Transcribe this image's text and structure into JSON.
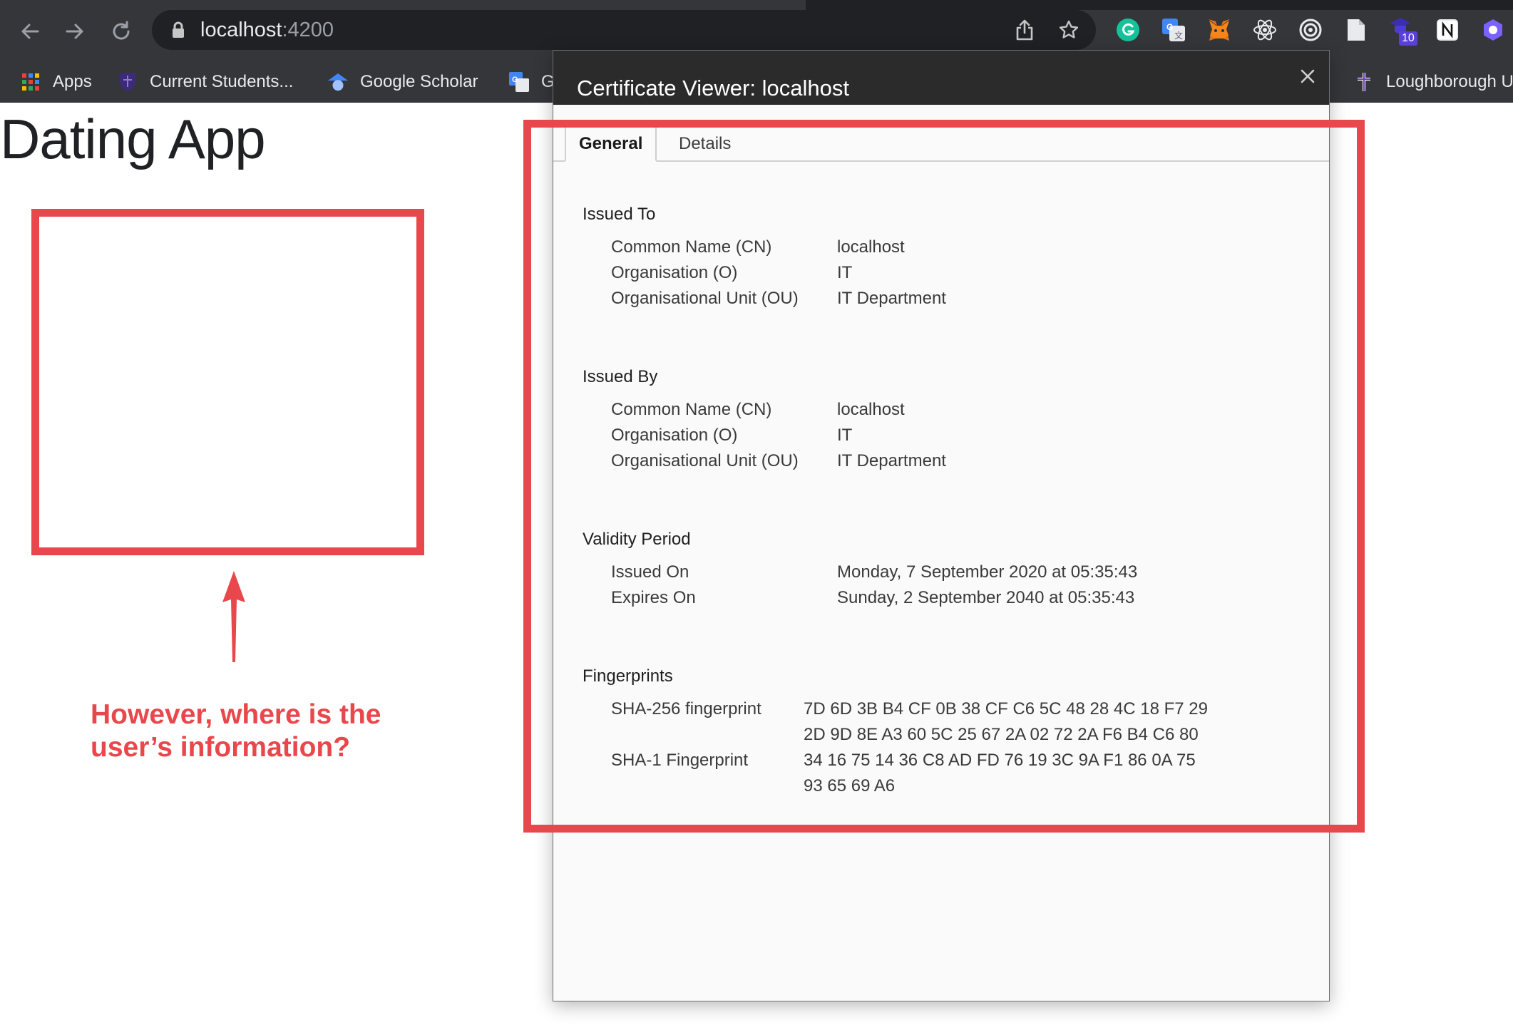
{
  "browser": {
    "url_host": "localhost",
    "url_port": ":4200",
    "bookmarks": [
      {
        "label": "Apps",
        "icon": "apps-grid-icon"
      },
      {
        "label": "Current Students...",
        "icon": "shield-crest-icon"
      },
      {
        "label": "Google Scholar",
        "icon": "scholar-cap-icon"
      },
      {
        "label": "G",
        "icon": "google-translate-icon"
      },
      {
        "label": "Loughborough U",
        "icon": "university-cross-icon"
      }
    ],
    "extension_badge": "10",
    "colors": {
      "chrome_bg": "#35363a",
      "omnibox_bg": "#202124",
      "annotation_red": "#e8474c"
    }
  },
  "page": {
    "title": "Dating App",
    "annotation_text_line1": "However, where is the",
    "annotation_text_line2": "user’s information?"
  },
  "dialog": {
    "title": "Certificate Viewer: localhost",
    "close_symbol": "✕",
    "tabs": [
      "General",
      "Details"
    ],
    "active_tab": "General",
    "issued_to": {
      "heading": "Issued To",
      "rows": [
        {
          "label": "Common Name (CN)",
          "value": "localhost"
        },
        {
          "label": "Organisation (O)",
          "value": "IT"
        },
        {
          "label": "Organisational Unit (OU)",
          "value": "IT Department"
        }
      ]
    },
    "issued_by": {
      "heading": "Issued By",
      "rows": [
        {
          "label": "Common Name (CN)",
          "value": "localhost"
        },
        {
          "label": "Organisation (O)",
          "value": "IT"
        },
        {
          "label": "Organisational Unit (OU)",
          "value": "IT Department"
        }
      ]
    },
    "validity": {
      "heading": "Validity Period",
      "rows": [
        {
          "label": "Issued On",
          "value": "Monday, 7 September 2020 at 05:35:43"
        },
        {
          "label": "Expires On",
          "value": "Sunday, 2 September 2040 at 05:35:43"
        }
      ]
    },
    "fingerprints": {
      "heading": "Fingerprints",
      "sha256_label": "SHA-256 fingerprint",
      "sha256_line1": "7D 6D 3B B4 CF 0B 38 CF C6 5C 48 28 4C 18 F7 29",
      "sha256_line2": "2D 9D 8E A3 60 5C 25 67 2A 02 72 2A F6 B4 C6 80",
      "sha1_label": "SHA-1 Fingerprint",
      "sha1_line1": "34 16 75 14 36 C8 AD FD 76 19 3C 9A F1 86 0A 75",
      "sha1_line2": "93 65 69 A6"
    }
  }
}
